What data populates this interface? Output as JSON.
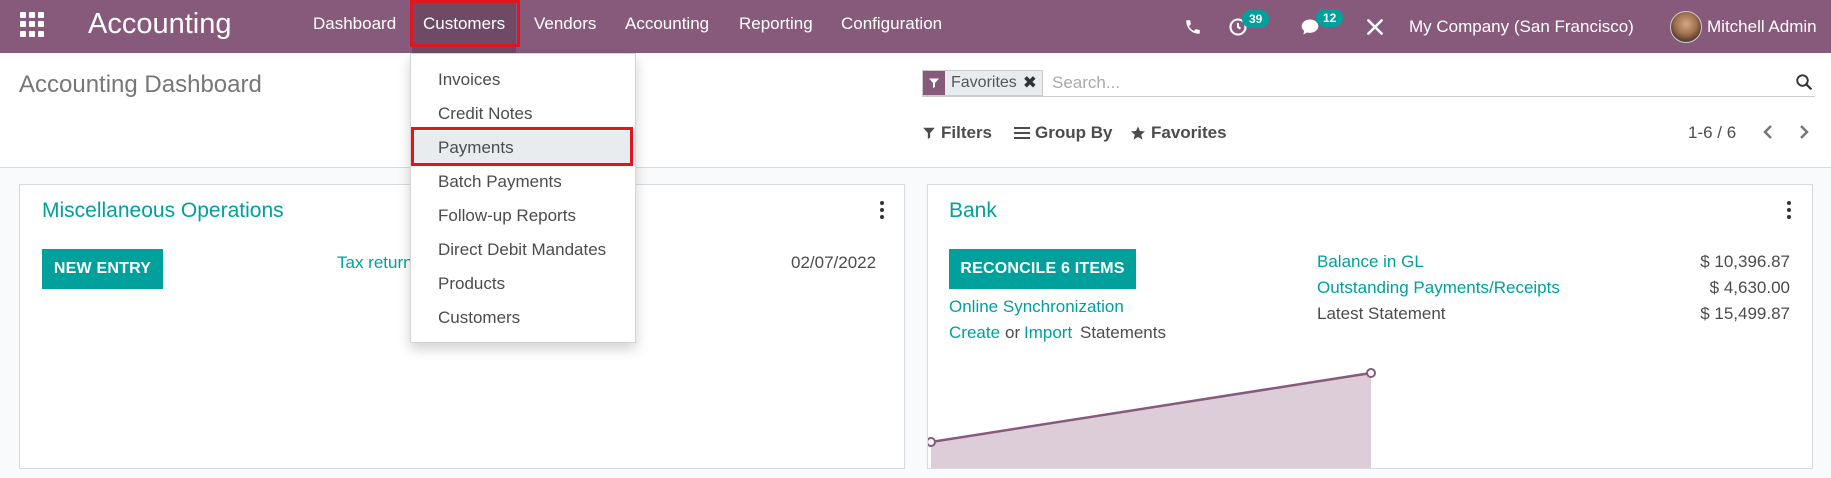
{
  "navbar": {
    "brand": "Accounting",
    "menu": [
      "Dashboard",
      "Customers",
      "Vendors",
      "Accounting",
      "Reporting",
      "Configuration"
    ],
    "active_menu": "Customers",
    "activity_count": "39",
    "messages_count": "12",
    "company": "My Company (San Francisco)",
    "user": "Mitchell Admin"
  },
  "control_panel": {
    "title": "Accounting Dashboard",
    "facet_label": "Favorites",
    "search_placeholder": "Search...",
    "filters_label": "Filters",
    "groupby_label": "Group By",
    "favorites_label": "Favorites",
    "pager": "1-6 / 6"
  },
  "dropdown": {
    "items": [
      "Invoices",
      "Credit Notes",
      "Payments",
      "Batch Payments",
      "Follow-up Reports",
      "Direct Debit Mandates",
      "Products",
      "Customers"
    ],
    "hovered": "Payments"
  },
  "misc_card": {
    "title": "Miscellaneous Operations",
    "button": "NEW ENTRY",
    "link": "Tax return",
    "date": "02/07/2022"
  },
  "bank_card": {
    "title": "Bank",
    "button": "RECONCILE 6 ITEMS",
    "online_sync": "Online Synchronization",
    "create": "Create",
    "or": "or",
    "import": "Import",
    "statements": "Statements",
    "rows": [
      {
        "label": "Balance in GL",
        "amount": "$ 10,396.87",
        "is_link": true
      },
      {
        "label": "Outstanding Payments/Receipts",
        "amount": "$ 4,630.00",
        "is_link": true
      },
      {
        "label": "Latest Statement",
        "amount": "$ 15,499.87",
        "is_link": false
      }
    ],
    "graph": {
      "line_color": "#875a7b",
      "fill_color": "#ddcdd8"
    }
  },
  "colors": {
    "brand": "#875a7b",
    "accent": "#00a09d",
    "highlight": "#e0151e"
  }
}
